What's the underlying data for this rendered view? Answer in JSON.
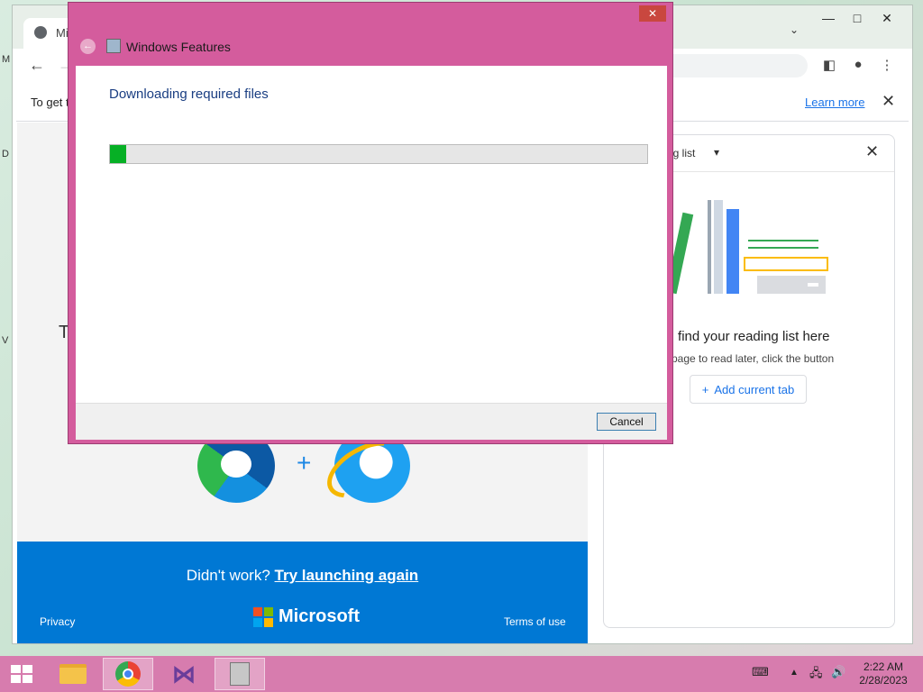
{
  "browser": {
    "tab_title": "Mi",
    "infobar_message": "To get t",
    "infobar_learn_more": "Learn more"
  },
  "page": {
    "partial_heading": "T",
    "retry_prefix": "Didn't work?",
    "retry_link": "Try launching again",
    "privacy": "Privacy",
    "brand": "Microsoft",
    "terms": "Terms of use",
    "brand_colors": [
      "#f25022",
      "#7fba00",
      "#00a4ef",
      "#ffb900"
    ]
  },
  "reading_list": {
    "title": "ng list",
    "empty_message": "u'll find your reading list here",
    "empty_sub": "a page to read later, click the button",
    "add_button": "Add current tab"
  },
  "dialog": {
    "title": "Windows Features",
    "heading": "Downloading required files",
    "progress_fraction": 0.03,
    "cancel": "Cancel",
    "progress_color": "#06b025"
  },
  "taskbar": {
    "time": "2:22 AM",
    "date": "2/28/2023",
    "accent": "#d77cae"
  }
}
